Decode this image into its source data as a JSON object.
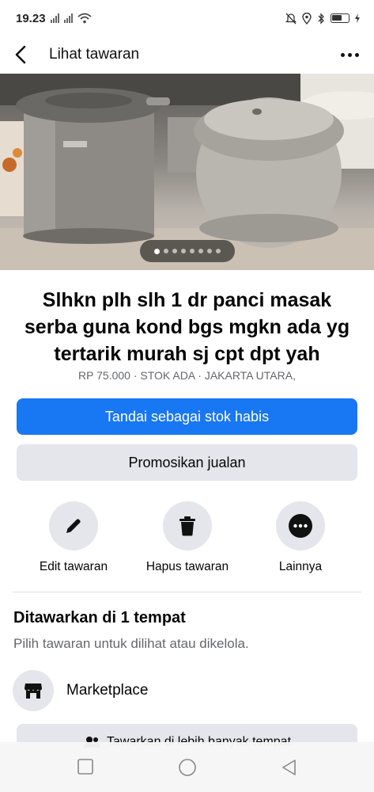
{
  "status_bar": {
    "time": "19.23",
    "signal_1": "signal-x-icon",
    "signal_2": "signal-x-icon",
    "wifi": "wifi-icon",
    "mute": "bell-off-icon",
    "location": "location-icon",
    "bluetooth": "bluetooth-icon",
    "battery": "battery-icon"
  },
  "header": {
    "title": "Lihat tawaran",
    "back_icon": "back-chevron-icon",
    "more_icon": "more-dots-icon"
  },
  "photo": {
    "page_count": 8,
    "current_page": 1
  },
  "listing": {
    "title": "Slhkn plh slh 1 dr panci masak serba guna kond bgs mgkn ada yg tertarik murah sj cpt dpt yah",
    "meta": "RP 75.000 · STOK ADA · JAKARTA UTARA,"
  },
  "buttons": {
    "mark_sold": "Tandai sebagai stok habis",
    "promote": "Promosikan jualan"
  },
  "actions": [
    {
      "label": "Edit tawaran",
      "icon": "pencil-icon"
    },
    {
      "label": "Hapus tawaran",
      "icon": "trash-icon"
    },
    {
      "label": "Lainnya",
      "icon": "more-circle-icon"
    }
  ],
  "offered": {
    "title": "Ditawarkan di 1 tempat",
    "subtitle": "Pilih tawaran untuk dilihat atau dikelola.",
    "place_label": "Marketplace",
    "place_icon": "shop-icon",
    "more_places_label": "Tawarkan di lebih banyak tempat",
    "more_places_icon": "people-icon"
  },
  "colors": {
    "primary": "#1877f2",
    "secondary_bg": "#e4e6eb",
    "muted_text": "#65676b"
  },
  "navbar": {
    "recents_icon": "square-icon",
    "home_icon": "circle-icon",
    "back_icon": "triangle-back-icon"
  }
}
